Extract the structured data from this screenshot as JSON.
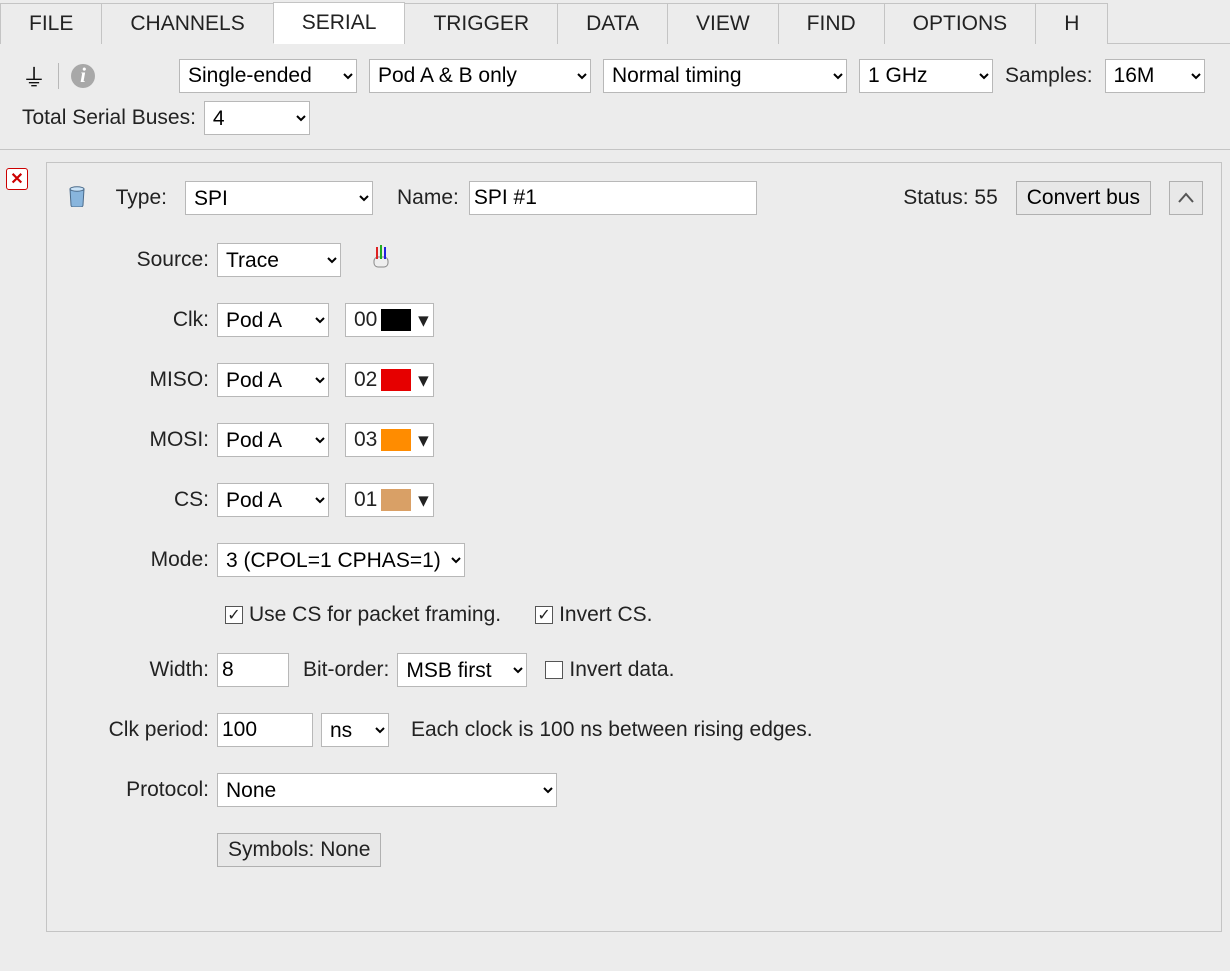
{
  "tabs": [
    "FILE",
    "CHANNELS",
    "SERIAL",
    "TRIGGER",
    "DATA",
    "VIEW",
    "FIND",
    "OPTIONS",
    "H"
  ],
  "active_tab": "SERIAL",
  "toolbar": {
    "signal_mode": "Single-ended",
    "pods": "Pod A & B only",
    "timing": "Normal timing",
    "sample_rate": "1 GHz",
    "samples_label": "Samples:",
    "samples": "16M",
    "total_buses_label": "Total Serial Buses:",
    "total_buses": "4"
  },
  "bus": {
    "type_label": "Type:",
    "type": "SPI",
    "name_label": "Name:",
    "name": "SPI #1",
    "status_label": "Status: 55",
    "convert_label": "Convert bus",
    "source_label": "Source:",
    "source": "Trace",
    "signals": {
      "clk": {
        "label": "Clk:",
        "pod": "Pod A",
        "ch": "00",
        "color": "#000000"
      },
      "miso": {
        "label": "MISO:",
        "pod": "Pod A",
        "ch": "02",
        "color": "#e60000"
      },
      "mosi": {
        "label": "MOSI:",
        "pod": "Pod A",
        "ch": "03",
        "color": "#ff8c00"
      },
      "cs": {
        "label": "CS:",
        "pod": "Pod A",
        "ch": "01",
        "color": "#d9a066"
      }
    },
    "mode_label": "Mode:",
    "mode": "3 (CPOL=1 CPHAS=1)",
    "use_cs_framing_label": "Use CS for packet framing.",
    "use_cs_framing": true,
    "invert_cs_label": "Invert CS.",
    "invert_cs": true,
    "width_label": "Width:",
    "width": "8",
    "bitorder_label": "Bit-order:",
    "bitorder": "MSB first",
    "invert_data_label": "Invert data.",
    "invert_data": false,
    "clk_period_label": "Clk period:",
    "clk_period": "100",
    "clk_unit": "ns",
    "clk_note": "Each clock is 100 ns between rising edges.",
    "protocol_label": "Protocol:",
    "protocol": "None",
    "symbols_btn": "Symbols: None"
  }
}
